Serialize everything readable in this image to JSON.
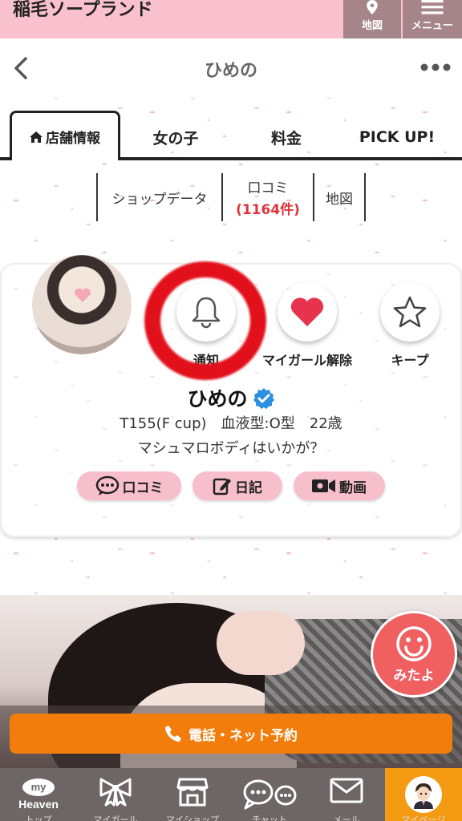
{
  "header": {
    "shop_name": "稲毛ソープランド",
    "map_label": "地図",
    "menu_label": "メニュー"
  },
  "titlebar": {
    "title": "ひめの"
  },
  "tabs": [
    {
      "label": "店舗情報",
      "icon": "home-icon",
      "active": true
    },
    {
      "label": "女の子",
      "active": false
    },
    {
      "label": "料金",
      "active": false
    },
    {
      "label": "PICK UP!",
      "active": false
    }
  ],
  "subnav": {
    "shop_data": "ショップデータ",
    "reviews": "口コミ",
    "reviews_count": "(1164件)",
    "map": "地図"
  },
  "profile": {
    "name": "ひめの",
    "verified_icon": "verified-badge-icon",
    "specs": "T155(F cup)　血液型:O型　22歳",
    "catchphrase": "マシュマロボディはいかが？",
    "actions": {
      "notify": "通知",
      "mygirl": "マイガール解除",
      "keep": "キープ"
    },
    "links": {
      "reviews": "口コミ",
      "diary": "日記",
      "video": "動画"
    }
  },
  "float": {
    "mitayo": "みたよ"
  },
  "callbar": {
    "label": "電話・ネット予約"
  },
  "bottomnav": {
    "items": [
      {
        "label": "トップ",
        "icon": "my-heaven-icon"
      },
      {
        "label": "マイガール",
        "icon": "ribbon-icon"
      },
      {
        "label": "マイショップ",
        "icon": "shop-icon"
      },
      {
        "label": "チャット",
        "icon": "chat-icon"
      },
      {
        "label": "メール",
        "icon": "mail-icon"
      },
      {
        "label": "マイページ",
        "icon": "user-avatar-icon"
      }
    ],
    "brand_my": "my",
    "brand_heaven": "Heaven"
  },
  "colors": {
    "topbar": "#f9c1cd",
    "accent_red": "#e0333a",
    "pill_pink": "#f7bfcb",
    "call_orange": "#f27d0c",
    "nav_gray": "#6e6666",
    "nav_active": "#f39a12"
  }
}
